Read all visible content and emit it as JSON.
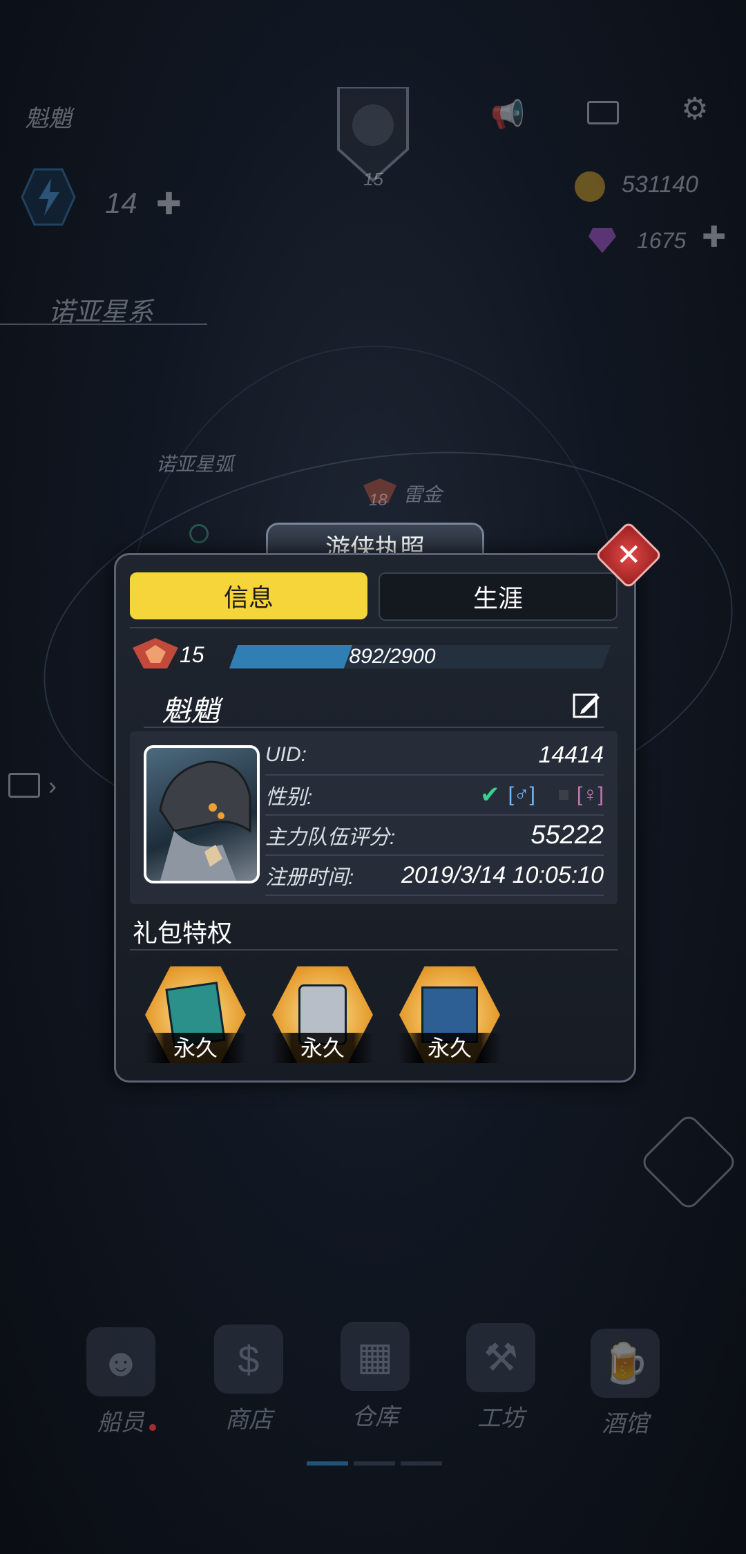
{
  "hud": {
    "player_name": "魁魈",
    "player_level": "15",
    "energy": "14",
    "gold": "531140",
    "gems": "1675"
  },
  "map": {
    "system_name": "诺亚星系",
    "arc_name": "诺亚星弧",
    "node_level": "18",
    "node_name": "雷金"
  },
  "bottom_nav": [
    {
      "label": "船员",
      "icon": "crew-icon"
    },
    {
      "label": "商店",
      "icon": "shop-icon"
    },
    {
      "label": "仓库",
      "icon": "warehouse-icon"
    },
    {
      "label": "工坊",
      "icon": "workshop-icon"
    },
    {
      "label": "酒馆",
      "icon": "tavern-icon"
    }
  ],
  "modal": {
    "title": "游侠执照",
    "tabs": {
      "info": "信息",
      "career": "生涯"
    },
    "level": "15",
    "xp_text": "892/2900",
    "xp_fraction": 0.3076,
    "name": "魁魈",
    "fields": {
      "uid_label": "UID:",
      "uid_value": "14414",
      "gender_label": "性别:",
      "score_label": "主力队伍评分:",
      "score_value": "55222",
      "reg_label": "注册时间:",
      "reg_value": "2019/3/14 10:05:10"
    },
    "perks_title": "礼包特权",
    "perks": [
      {
        "label": "永久"
      },
      {
        "label": "永久"
      },
      {
        "label": "永久"
      }
    ]
  },
  "colors": {
    "tab_active": "#f5d53a",
    "xp_fill": "#2f7fb5",
    "close": "#d63a3a"
  }
}
